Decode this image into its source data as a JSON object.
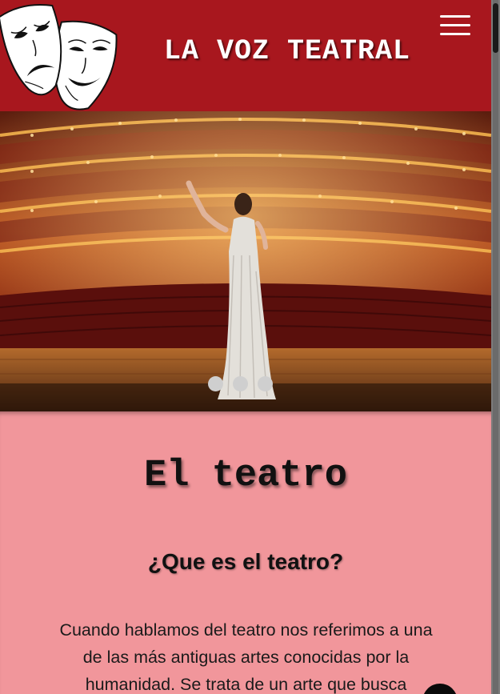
{
  "header": {
    "site_title": "LA VOZ TEATRAL",
    "logo_icon": "theatre-masks-icon",
    "menu_icon": "hamburger-menu-icon",
    "background_color": "#a8171e"
  },
  "hero": {
    "image_subject": "opera-house-stage",
    "slides_total": 3,
    "active_slide": 1
  },
  "content": {
    "heading": "El teatro",
    "subheading": "¿Que es el teatro?",
    "paragraph": "Cuando hablamos del teatro nos referimos a una de las más antiguas artes conocidas por la humanidad. Se trata de un arte que busca",
    "background_color": "#f1969b"
  },
  "floating_button": {
    "icon": "chat-icon"
  }
}
